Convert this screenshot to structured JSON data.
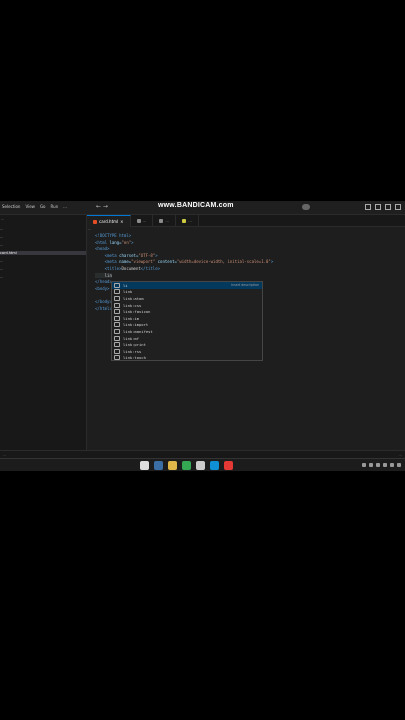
{
  "titlebar": {
    "menu": [
      "Selection",
      "View",
      "Go",
      "Run",
      "..."
    ],
    "watermark": "www.BANDICAM.com",
    "nav": "← →"
  },
  "sidebar": {
    "title": "...",
    "items": [
      "...",
      "...",
      "...",
      "card.html",
      "...",
      "...",
      "..."
    ]
  },
  "tabs": [
    {
      "label": "card.html",
      "color": "#e44d26",
      "active": true
    },
    {
      "label": "...",
      "color": "#8b8b8b",
      "active": false
    },
    {
      "label": "...",
      "color": "#8b8b8b",
      "active": false
    },
    {
      "label": "...",
      "color": "#cbcb41",
      "active": false
    }
  ],
  "breadcrumb": "...",
  "code": {
    "l1": "<!DOCTYPE html>",
    "l2_tag": "<html",
    "l2_attr": " lang=",
    "l2_str": "\"en\"",
    "l2_end": ">",
    "l3": "<head>",
    "l4_tag": "<meta",
    "l4_attr": " charset=",
    "l4_str": "\"UTF-8\"",
    "l4_end": ">",
    "l5_tag": "<meta",
    "l5_attr1": " name=",
    "l5_str1": "\"viewport\"",
    "l5_attr2": " content=",
    "l5_str2": "\"width=device-width, initial-scale=1.0\"",
    "l5_end": ">",
    "l6_open": "<title>",
    "l6_text": "Document",
    "l6_close": "</title>",
    "l7": "lin",
    "l8": "</head>",
    "l9": "<body>",
    "l10": "</body>",
    "l11": "</html>"
  },
  "suggest": {
    "detail": "Insert description",
    "items": [
      "li",
      "link",
      "link:atom",
      "link:css",
      "link:favicon",
      "link:im",
      "link:import",
      "link:manifest",
      "link:mf",
      "link:print",
      "link:rss",
      "link:touch"
    ]
  },
  "statusbar": {
    "left": "...",
    "right": "..."
  },
  "taskbar": {
    "icons": [
      "#dddddd",
      "#3a6ea5",
      "#e0b84a",
      "#34a853",
      "#cccccc",
      "#0e8fd6",
      "#e53935"
    ]
  }
}
